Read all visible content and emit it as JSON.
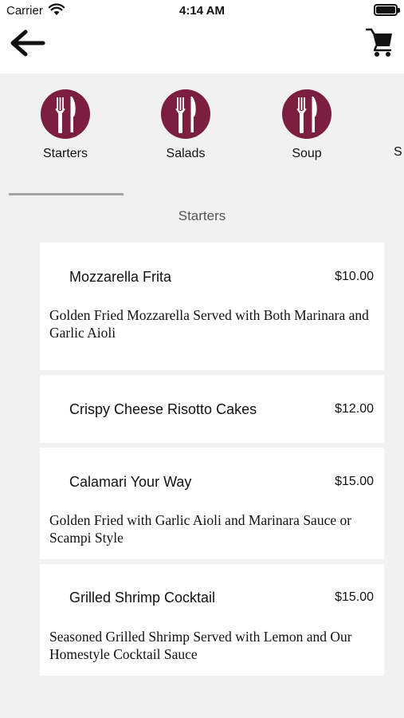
{
  "status": {
    "carrier": "Carrier",
    "time": "4:14 AM"
  },
  "nav": {
    "back_icon": "arrow-left-icon",
    "cart_icon": "shopping-cart-icon"
  },
  "categories": {
    "icon": "utensils-icon",
    "icon_color": "#7b1e3f",
    "items": [
      {
        "label": "Starters"
      },
      {
        "label": "Salads"
      },
      {
        "label": "Soup"
      }
    ],
    "partial_label_glyph": "S"
  },
  "section": {
    "title": "Starters"
  },
  "menu_items": [
    {
      "name": "Mozzarella Frita",
      "price": "$10.00",
      "description": "Golden Fried Mozzarella Served with Both Marinara and Garlic Aioli"
    },
    {
      "name": "Crispy Cheese Risotto Cakes",
      "price": "$12.00",
      "description": ""
    },
    {
      "name": "Calamari Your Way",
      "price": "$15.00",
      "description": "Golden Fried with Garlic Aioli and Marinara Sauce or Scampi Style"
    },
    {
      "name": "Grilled Shrimp Cocktail",
      "price": "$15.00",
      "description": "Seasoned Grilled Shrimp Served with Lemon and Our Homestyle Cocktail Sauce"
    }
  ]
}
